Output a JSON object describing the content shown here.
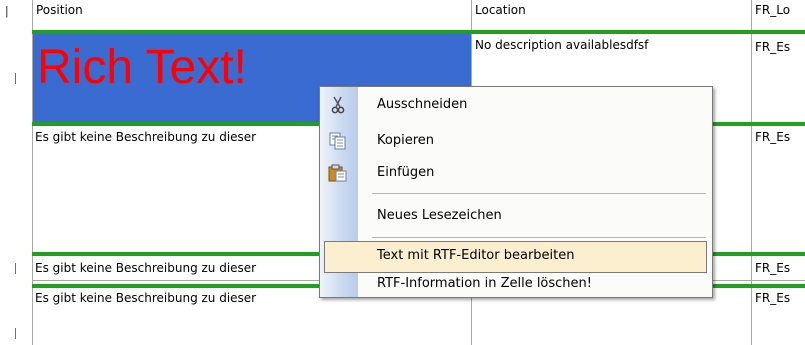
{
  "columns": [
    {
      "label": "Position"
    },
    {
      "label": "Location"
    },
    {
      "label": "FR_Lo"
    }
  ],
  "rows": [
    {
      "position": "Rich Text!",
      "location": "No description availablesdfsf",
      "fr": "FR_Es"
    },
    {
      "position": "Es gibt keine Beschreibung zu dieser",
      "location": "",
      "fr": "FR_Es"
    },
    {
      "position": "Es gibt keine Beschreibung zu dieser",
      "location": "",
      "fr": "FR_Es"
    },
    {
      "position": "Es gibt keine Beschreibung zu dieser",
      "location": "",
      "fr": "FR_Es"
    }
  ],
  "context_menu": {
    "items": [
      {
        "label": "Ausschneiden",
        "icon": "scissors-icon"
      },
      {
        "label": "Kopieren",
        "icon": "copy-icon"
      },
      {
        "label": "Einfügen",
        "icon": "paste-icon"
      },
      {
        "label": "Neues Lesezeichen",
        "icon": ""
      },
      {
        "label": "Text mit RTF-Editor bearbeiten",
        "icon": "",
        "highlighted": true
      },
      {
        "label": "RTF-Information in Zelle löschen!",
        "icon": ""
      }
    ]
  },
  "colors": {
    "rich_text_cell_bg": "#3a6bd0",
    "rich_text_color": "#ff0000",
    "row_separator": "#1fa01f",
    "menu_highlight": "#fbefcf"
  }
}
